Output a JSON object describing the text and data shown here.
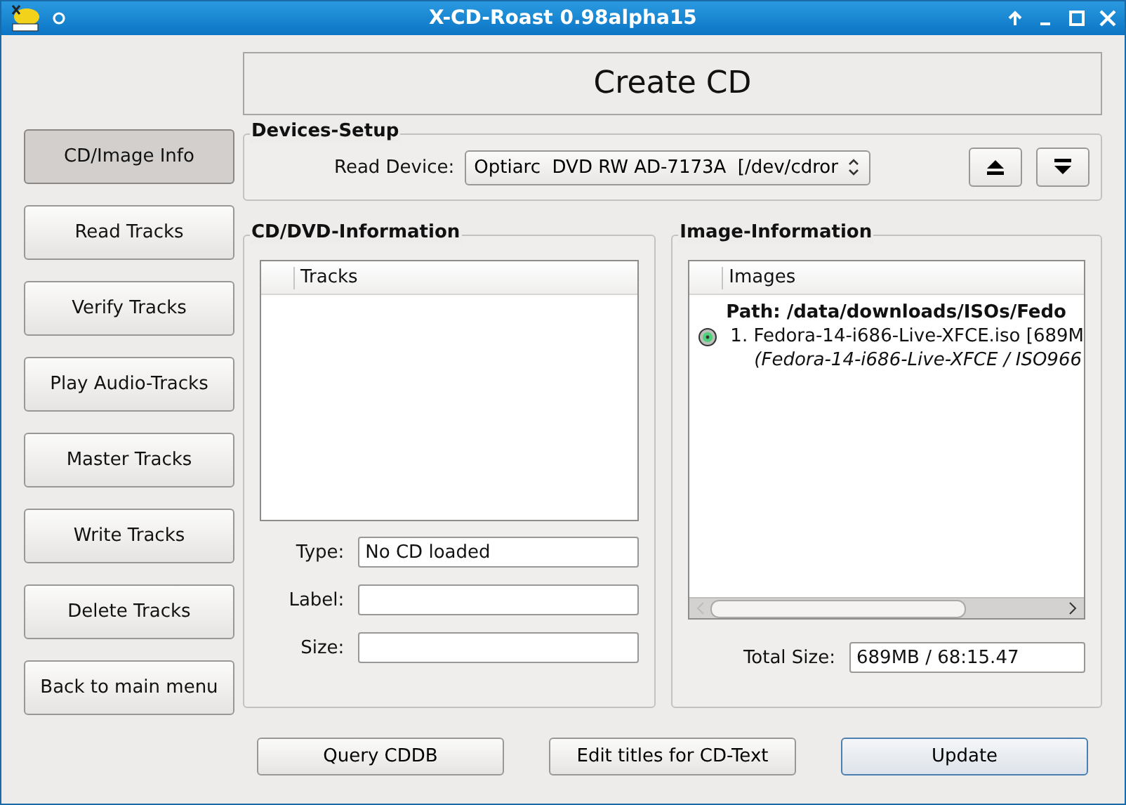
{
  "window": {
    "title": "X-CD-Roast 0.98alpha15"
  },
  "header": "Create CD",
  "sidebar": {
    "items": [
      {
        "label": "CD/Image Info",
        "selected": true
      },
      {
        "label": "Read Tracks",
        "selected": false
      },
      {
        "label": "Verify Tracks",
        "selected": false
      },
      {
        "label": "Play Audio-Tracks",
        "selected": false
      },
      {
        "label": "Master Tracks",
        "selected": false
      },
      {
        "label": "Write Tracks",
        "selected": false
      },
      {
        "label": "Delete Tracks",
        "selected": false
      },
      {
        "label": "Back to main menu",
        "selected": false
      }
    ]
  },
  "devices_setup": {
    "title": "Devices-Setup",
    "read_device_label": "Read Device:",
    "read_device": "Optiarc  DVD RW AD-7173A  [/dev/cdror"
  },
  "cd_info": {
    "title": "CD/DVD-Information",
    "column": "Tracks",
    "fields": [
      {
        "label": "Type:",
        "value": "No CD loaded"
      },
      {
        "label": "Label:"
      },
      {
        "label": "Size:"
      }
    ]
  },
  "image_info": {
    "title": "Image-Information",
    "column": "Images",
    "rows": [
      {
        "kind": "path",
        "text": "Path: /data/downloads/ISOs/Fedo"
      },
      {
        "kind": "file",
        "text": "1. Fedora-14-i686-Live-XFCE.iso [689M"
      },
      {
        "kind": "detail",
        "text": "(Fedora-14-i686-Live-XFCE / ISO966"
      }
    ],
    "total_label": "Total Size:",
    "total_value": "689MB / 68:15.47"
  },
  "buttons": [
    "Query CDDB",
    "Edit titles for CD-Text",
    "Update"
  ]
}
